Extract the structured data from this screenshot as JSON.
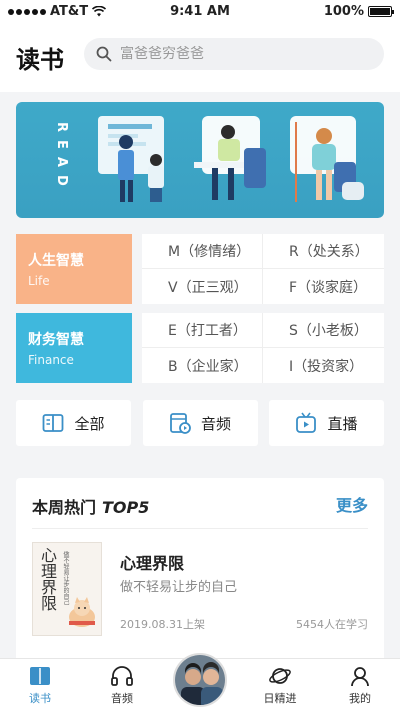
{
  "status_bar": {
    "carrier": "AT&T",
    "time": "9:41 AM",
    "battery": "100%"
  },
  "header": {
    "title": "读书",
    "search_placeholder": "富爸爸穷爸爸"
  },
  "banner": {
    "vertical_text": "READ"
  },
  "categories": [
    {
      "name": "人生智慧",
      "name_en": "Life",
      "color": "#f9b388",
      "items": [
        "M（修情绪）",
        "R（处关系）",
        "V（正三观）",
        "F（谈家庭）"
      ]
    },
    {
      "name": "财务智慧",
      "name_en": "Finance",
      "color": "#3fb8dd",
      "items": [
        "E（打工者）",
        "S（小老板）",
        "B（企业家）",
        "I（投资家）"
      ]
    }
  ],
  "quick_actions": [
    {
      "label": "全部",
      "icon": "book-icon"
    },
    {
      "label": "音频",
      "icon": "audio-icon"
    },
    {
      "label": "直播",
      "icon": "live-tv-icon"
    }
  ],
  "top5": {
    "title": "本周热门",
    "title_italic": "TOP5",
    "more": "更多",
    "book": {
      "cover_title": "心理界限",
      "cover_subtitle": "做不轻易让步的自己",
      "name": "心理界限",
      "desc": "做不轻易让步的自己",
      "date": "2019.08.31上架",
      "learners": "5454人在学习"
    }
  },
  "tabbar": {
    "items": [
      {
        "label": "读书",
        "icon": "book-tab-icon",
        "active": true
      },
      {
        "label": "音频",
        "icon": "headphones-icon",
        "active": false
      },
      {
        "label": "日精进",
        "icon": "planet-icon",
        "active": false
      },
      {
        "label": "我的",
        "icon": "user-icon",
        "active": false
      }
    ]
  },
  "colors": {
    "accent": "#3a8fc7",
    "banner": "#3fa9c9"
  }
}
